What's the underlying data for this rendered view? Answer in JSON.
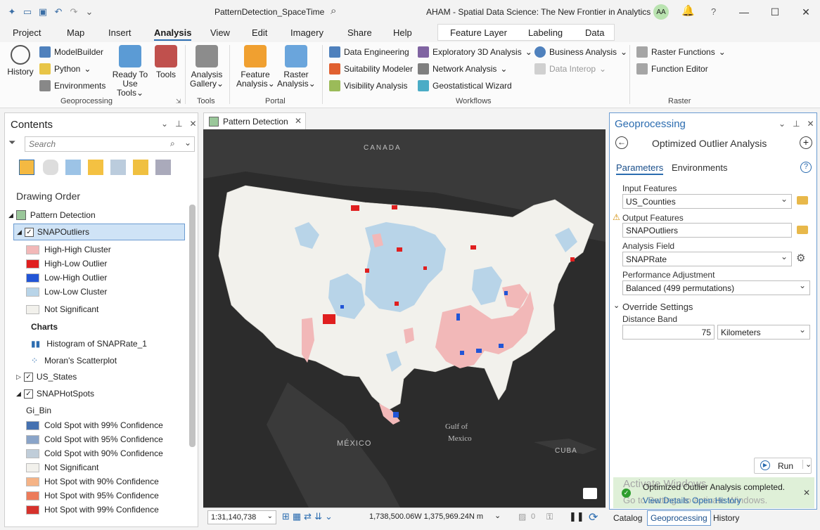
{
  "titlebar": {
    "doc_title": "PatternDetection_SpaceTime",
    "app_title": "AHAM - Spatial Data Science:  The New Frontier in Analytics",
    "avatar": "AA",
    "help": "?"
  },
  "ribbon_tabs": [
    "Project",
    "Map",
    "Insert",
    "Analysis",
    "View",
    "Edit",
    "Imagery",
    "Share",
    "Help"
  ],
  "context_tabs": [
    "Feature Layer",
    "Labeling",
    "Data"
  ],
  "ribbon": {
    "history": "History",
    "modelbuilder": "ModelBuilder",
    "python": "Python",
    "environments": "Environments",
    "ready_to_use_1": "Ready To",
    "ready_to_use_2": "Use Tools",
    "tools": "Tools",
    "analysis_gallery_1": "Analysis",
    "analysis_gallery_2": "Gallery",
    "feature_analysis_1": "Feature",
    "feature_analysis_2": "Analysis",
    "raster_analysis_1": "Raster",
    "raster_analysis_2": "Analysis",
    "data_engineering": "Data Engineering",
    "suitability_modeler": "Suitability Modeler",
    "visibility_analysis": "Visibility Analysis",
    "exploratory_3d": "Exploratory 3D Analysis",
    "network_analysis": "Network Analysis",
    "geostatistical_wizard": "Geostatistical Wizard",
    "business_analysis": "Business Analysis",
    "data_interop": "Data Interop",
    "raster_functions": "Raster Functions",
    "function_editor": "Function Editor",
    "groups": {
      "geoprocessing": "Geoprocessing",
      "tools": "Tools",
      "portal": "Portal",
      "workflows": "Workflows",
      "raster": "Raster"
    }
  },
  "contents": {
    "title": "Contents",
    "search_placeholder": "Search",
    "drawing_order": "Drawing Order",
    "map_name": "Pattern Detection",
    "layer_outliers": "SNAPOutliers",
    "outlier_legend": [
      {
        "label": "High-High Cluster",
        "color": "#f2b8b8"
      },
      {
        "label": "High-Low Outlier",
        "color": "#e01f1f"
      },
      {
        "label": "Low-High Outlier",
        "color": "#2255d6"
      },
      {
        "label": "Low-Low Cluster",
        "color": "#b8d4e8"
      },
      {
        "label": "Not Significant",
        "color": "#f2f1ec"
      }
    ],
    "charts_label": "Charts",
    "chart_histogram": "Histogram of SNAPRate_1",
    "chart_moran": "Moran's Scatterplot",
    "layer_states": "US_States",
    "layer_hotspots": "SNAPHotSpots",
    "gi_bin_label": "Gi_Bin",
    "hotspot_legend": [
      {
        "label": "Cold Spot with 99% Confidence",
        "color": "#4571b0"
      },
      {
        "label": "Cold Spot with 95% Confidence",
        "color": "#8aa4c8"
      },
      {
        "label": "Cold Spot with 90% Confidence",
        "color": "#c0cdd9"
      },
      {
        "label": "Not Significant",
        "color": "#f2f1ec"
      },
      {
        "label": "Hot Spot with 90% Confidence",
        "color": "#f5b386"
      },
      {
        "label": "Hot Spot with 95% Confidence",
        "color": "#ec7b5a"
      },
      {
        "label": "Hot Spot with 99% Confidence",
        "color": "#d6322c"
      }
    ]
  },
  "map": {
    "tab_title": "Pattern Detection",
    "labels": {
      "canada": "CANADA",
      "mexico": "MÉXICO",
      "gulf1": "Gulf of",
      "gulf2": "Mexico",
      "cuba": "CUBA"
    },
    "scale": "1:31,140,738",
    "coords": "1,738,500.06W 1,375,969.24N m",
    "selected_count": "0"
  },
  "geoprocessing": {
    "title": "Geoprocessing",
    "tool_title": "Optimized Outlier Analysis",
    "tab_parameters": "Parameters",
    "tab_environments": "Environments",
    "input_features_label": "Input Features",
    "input_features_value": "US_Counties",
    "output_features_label": "Output Features",
    "output_features_value": "SNAPOutliers",
    "analysis_field_label": "Analysis Field",
    "analysis_field_value": "SNAPRate",
    "performance_label": "Performance Adjustment",
    "performance_value": "Balanced (499 permutations)",
    "override_label": "Override Settings",
    "distance_band_label": "Distance Band",
    "distance_band_value": "75",
    "distance_unit": "Kilometers",
    "run_label": "Run",
    "status_message": "Optimized Outlier Analysis completed.",
    "view_details": "View Details",
    "open_history": "Open History",
    "watermark_1": "Activate Windows",
    "watermark_2": "Go to Settings to activate Windows."
  },
  "bottom_tabs": [
    "Catalog",
    "Geoprocessing",
    "History"
  ]
}
